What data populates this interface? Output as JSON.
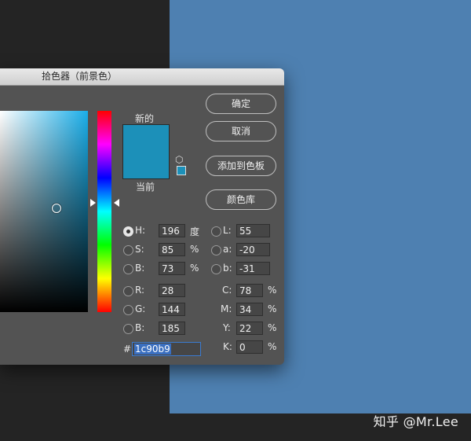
{
  "dialog": {
    "title": "拾色器（前景色）",
    "new_label": "新的",
    "current_label": "当前",
    "new_color": "#1c90b9",
    "current_color": "#1c90b9"
  },
  "buttons": {
    "ok": "确定",
    "cancel": "取消",
    "add_to_swatches": "添加到色板",
    "color_libraries": "颜色库"
  },
  "hsb": {
    "h_label": "H:",
    "h_value": "196",
    "h_unit": "度",
    "s_label": "S:",
    "s_value": "85",
    "s_unit": "%",
    "b_label": "B:",
    "b_value": "73",
    "b_unit": "%"
  },
  "lab": {
    "l_label": "L:",
    "l_value": "55",
    "a_label": "a:",
    "a_value": "-20",
    "b_label": "b:",
    "b_value": "-31"
  },
  "rgb": {
    "r_label": "R:",
    "r_value": "28",
    "g_label": "G:",
    "g_value": "144",
    "b_label": "B:",
    "b_value": "185"
  },
  "cmyk": {
    "c_label": "C:",
    "c_value": "78",
    "c_unit": "%",
    "m_label": "M:",
    "m_value": "34",
    "m_unit": "%",
    "y_label": "Y:",
    "y_value": "22",
    "y_unit": "%",
    "k_label": "K:",
    "k_value": "0",
    "k_unit": "%"
  },
  "hex": {
    "label": "#",
    "value": "1c90b9"
  },
  "watermark": "知乎 @Mr.Lee",
  "colors": {
    "accent": "#1c90b9",
    "background_blue": "#4e80b1",
    "dialog_bg": "#535353"
  }
}
